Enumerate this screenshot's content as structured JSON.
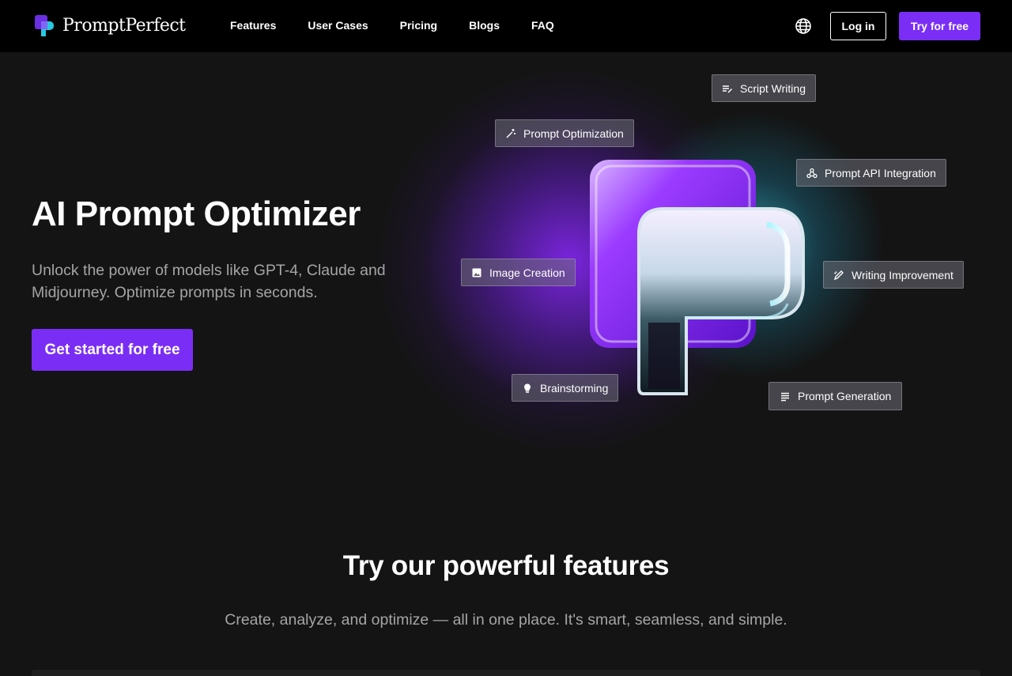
{
  "brand": {
    "name": "PromptPerfect",
    "colors": {
      "accent": "#7a2ef5",
      "logo_purple": "#6a2fe0",
      "logo_cyan": "#27c8e0",
      "background": "#141414"
    }
  },
  "nav": {
    "links": [
      {
        "label": "Features"
      },
      {
        "label": "User Cases"
      },
      {
        "label": "Pricing"
      },
      {
        "label": "Blogs"
      },
      {
        "label": "FAQ"
      }
    ],
    "language_icon": "globe-icon",
    "login_label": "Log in",
    "try_label": "Try for free"
  },
  "hero": {
    "title": "AI Prompt Optimizer",
    "subtitle": "Unlock the power of models like GPT-4, Claude and Midjourney. Optimize prompts in seconds.",
    "cta_label": "Get started for free"
  },
  "tags": [
    {
      "label": "Script Writing",
      "icon": "script-icon"
    },
    {
      "label": "Prompt Optimization",
      "icon": "magic-wand-icon"
    },
    {
      "label": "Prompt API Integration",
      "icon": "webhook-icon"
    },
    {
      "label": "Image Creation",
      "icon": "image-icon"
    },
    {
      "label": "Writing Improvement",
      "icon": "edit-icon"
    },
    {
      "label": "Brainstorming",
      "icon": "bulb-icon"
    },
    {
      "label": "Prompt Generation",
      "icon": "notes-icon"
    }
  ],
  "features": {
    "title": "Try our powerful features",
    "subtitle": "Create, analyze, and optimize — all in one place. It's smart, seamless, and simple."
  }
}
